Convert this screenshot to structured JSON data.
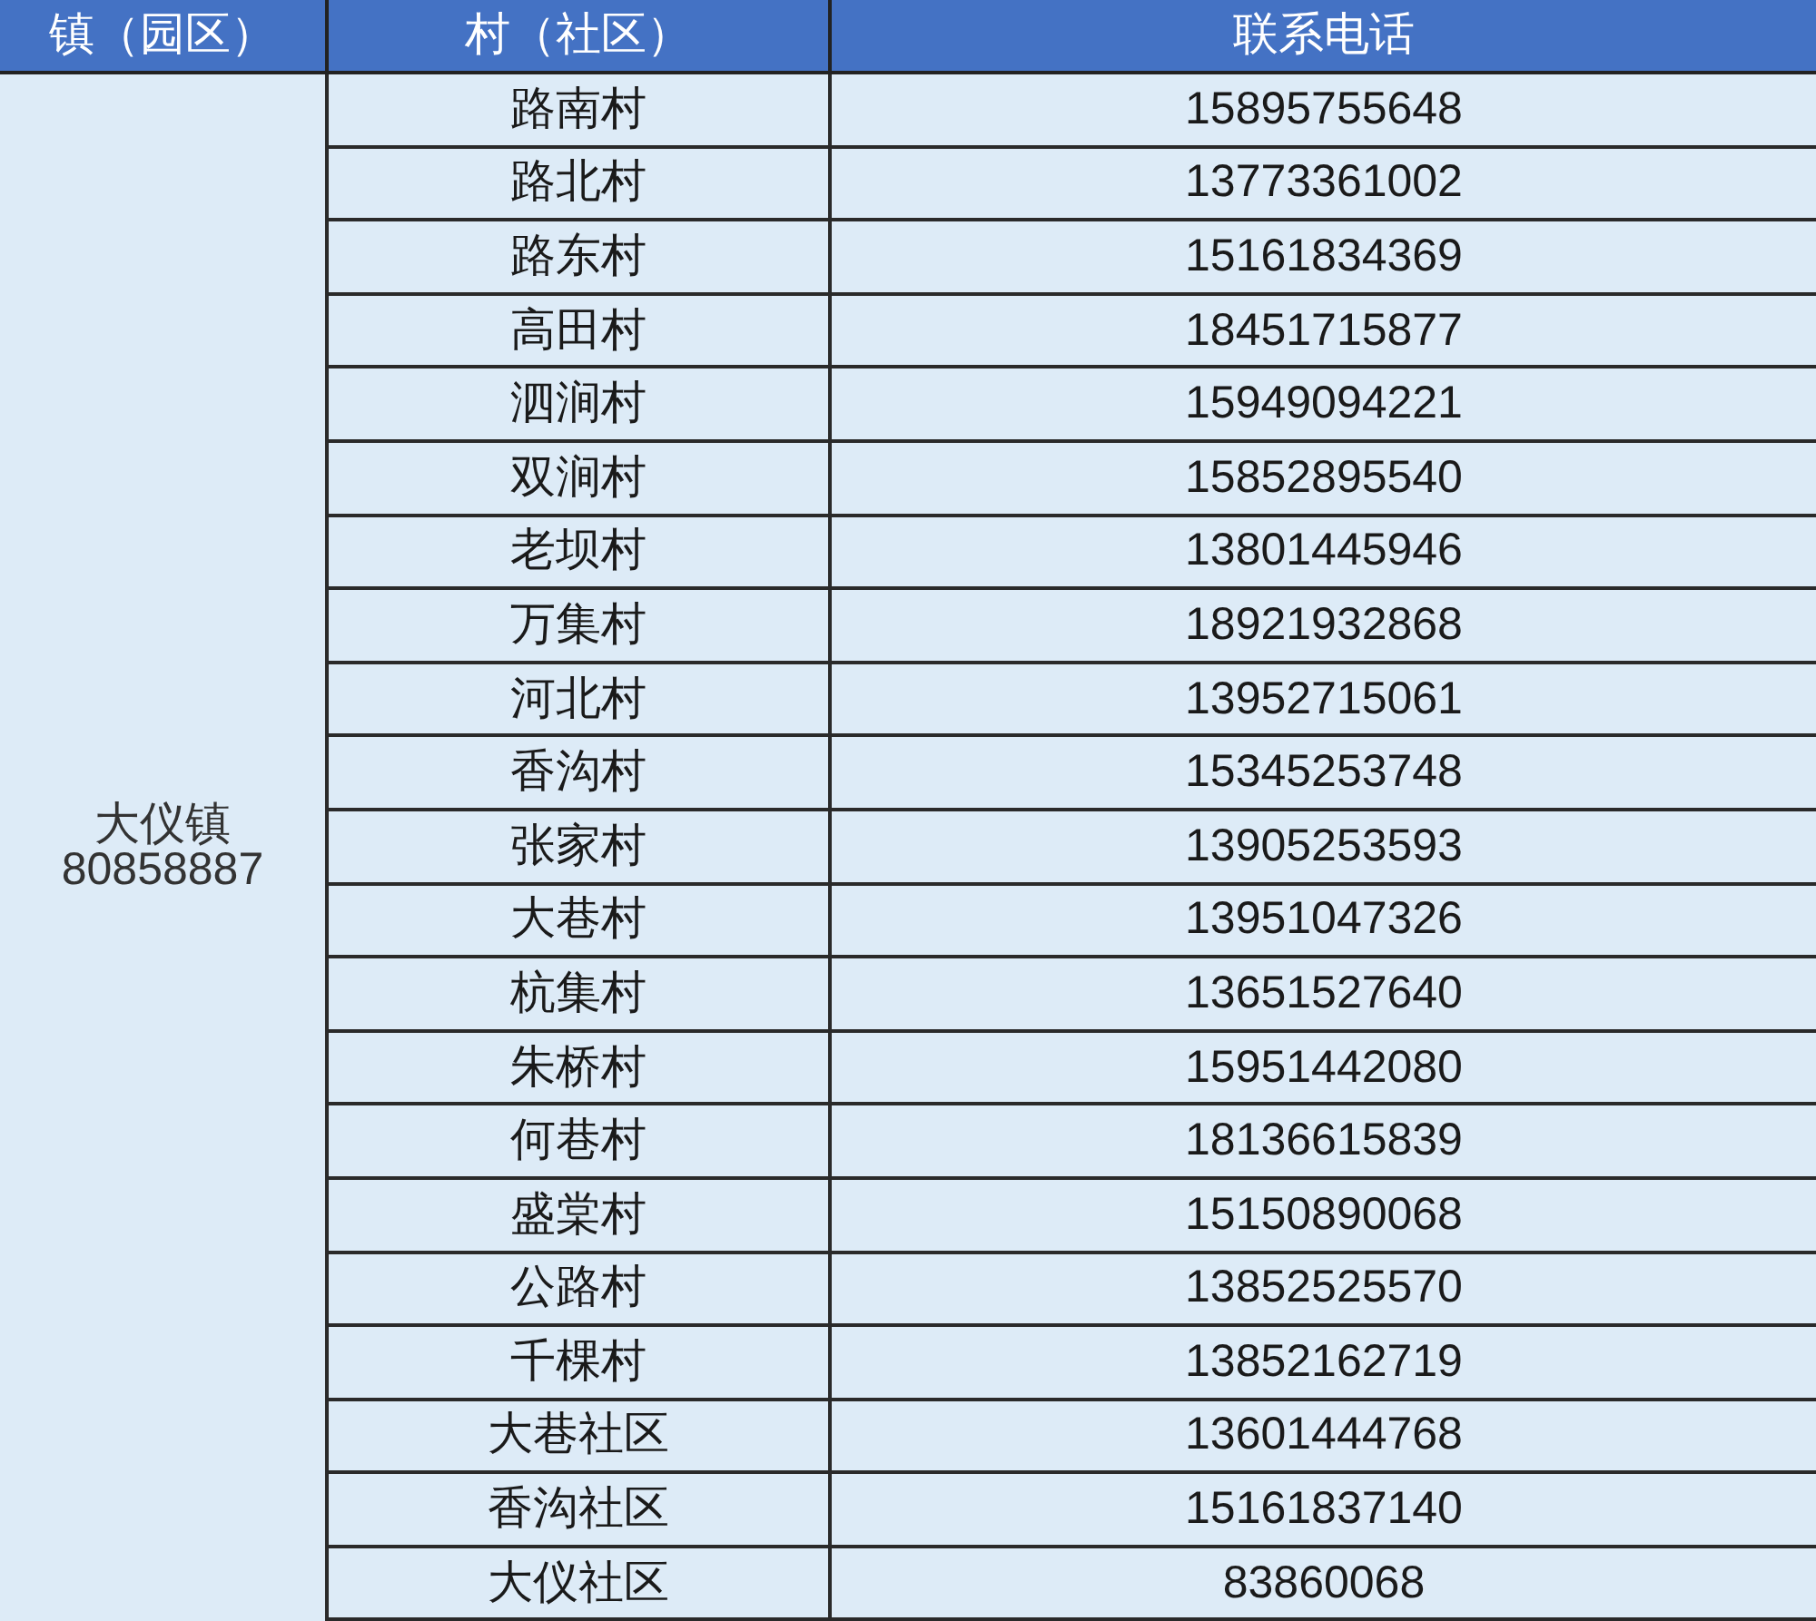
{
  "table": {
    "columns": [
      "镇（园区）",
      "村（社区）",
      "联系电话"
    ],
    "town": {
      "name": "大仪镇",
      "phone": "80858887"
    },
    "rows": [
      {
        "village": "路南村",
        "phone": "15895755648"
      },
      {
        "village": "路北村",
        "phone": "13773361002"
      },
      {
        "village": "路东村",
        "phone": "15161834369"
      },
      {
        "village": "高田村",
        "phone": "18451715877"
      },
      {
        "village": "泗涧村",
        "phone": "15949094221"
      },
      {
        "village": "双涧村",
        "phone": "15852895540"
      },
      {
        "village": "老坝村",
        "phone": "13801445946"
      },
      {
        "village": "万集村",
        "phone": "18921932868"
      },
      {
        "village": "河北村",
        "phone": "13952715061"
      },
      {
        "village": "香沟村",
        "phone": "15345253748"
      },
      {
        "village": "张家村",
        "phone": "13905253593"
      },
      {
        "village": "大巷村",
        "phone": "13951047326"
      },
      {
        "village": "杭集村",
        "phone": "13651527640"
      },
      {
        "village": "朱桥村",
        "phone": "15951442080"
      },
      {
        "village": "何巷村",
        "phone": "18136615839"
      },
      {
        "village": "盛棠村",
        "phone": "15150890068"
      },
      {
        "village": "公路村",
        "phone": "13852525570"
      },
      {
        "village": "千棵村",
        "phone": "13852162719"
      },
      {
        "village": "大巷社区",
        "phone": "13601444768"
      },
      {
        "village": "香沟社区",
        "phone": "15161837140"
      },
      {
        "village": "大仪社区",
        "phone": "83860068"
      }
    ]
  }
}
